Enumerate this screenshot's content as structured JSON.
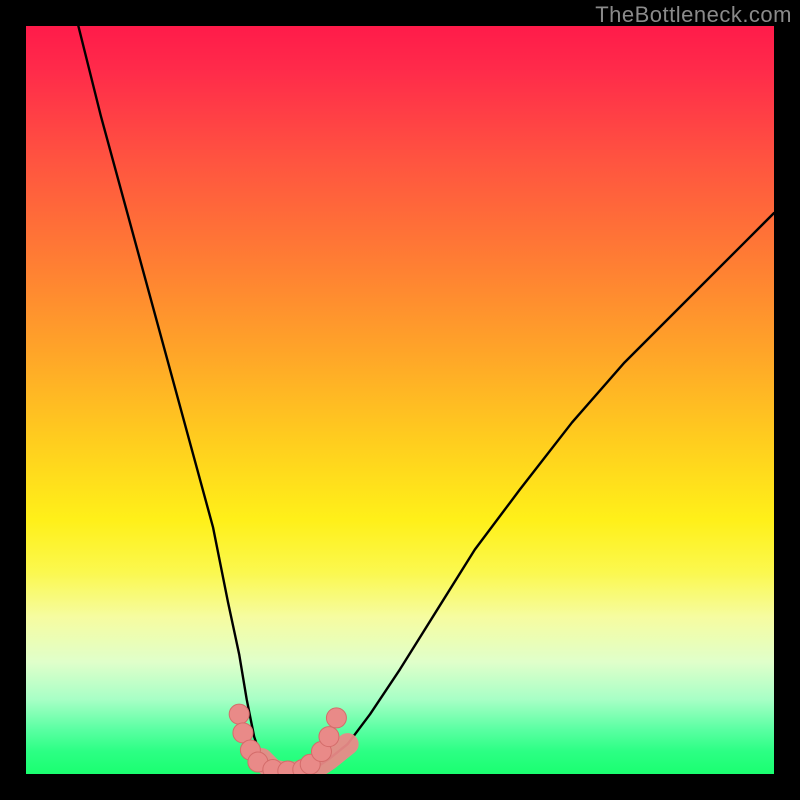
{
  "branding": {
    "watermark": "TheBottleneck.com"
  },
  "chart_data": {
    "type": "line",
    "title": "",
    "xlabel": "",
    "ylabel": "",
    "xlim": [
      0,
      100
    ],
    "ylim": [
      0,
      100
    ],
    "grid": false,
    "legend": false,
    "series": [
      {
        "name": "bottleneck-curve",
        "x": [
          7,
          10,
          13,
          16,
          19,
          22,
          25,
          27,
          28.5,
          29.5,
          30.5,
          31.5,
          33,
          34.5,
          36,
          37.5,
          39,
          40.5,
          43,
          46,
          50,
          55,
          60,
          66,
          73,
          80,
          88,
          96,
          100
        ],
        "y": [
          100,
          88,
          77,
          66,
          55,
          44,
          33,
          23,
          16,
          10,
          5,
          2,
          0.5,
          0.2,
          0.2,
          0.4,
          1,
          2,
          4,
          8,
          14,
          22,
          30,
          38,
          47,
          55,
          63,
          71,
          75
        ]
      }
    ],
    "markers": [
      {
        "x": 28.5,
        "y": 8.0
      },
      {
        "x": 29.0,
        "y": 5.5
      },
      {
        "x": 30.0,
        "y": 3.2
      },
      {
        "x": 31.0,
        "y": 1.6
      },
      {
        "x": 33.0,
        "y": 0.6
      },
      {
        "x": 35.0,
        "y": 0.4
      },
      {
        "x": 37.0,
        "y": 0.6
      },
      {
        "x": 38.0,
        "y": 1.3
      },
      {
        "x": 39.5,
        "y": 3.0
      },
      {
        "x": 40.5,
        "y": 5.0
      },
      {
        "x": 41.5,
        "y": 7.5
      }
    ],
    "colors": {
      "curve_stroke": "#000000",
      "marker_fill": "#e98a88",
      "marker_stroke": "#d46c6a",
      "bottom_stroke": "#e98a88"
    }
  }
}
